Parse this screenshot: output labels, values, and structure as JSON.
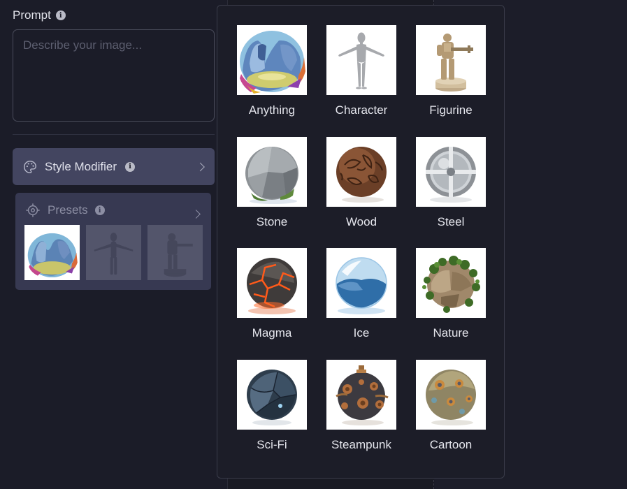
{
  "prompt": {
    "label": "Prompt",
    "placeholder": "Describe your image...",
    "value": ""
  },
  "style_modifier": {
    "label": "Style Modifier",
    "icon": "palette-icon"
  },
  "presets": {
    "label": "Presets",
    "icon": "target-icon",
    "thumbs": [
      "Anything",
      "Character",
      "Figurine"
    ]
  },
  "style_options": [
    {
      "label": "Anything"
    },
    {
      "label": "Character"
    },
    {
      "label": "Figurine"
    },
    {
      "label": "Stone"
    },
    {
      "label": "Wood"
    },
    {
      "label": "Steel"
    },
    {
      "label": "Magma"
    },
    {
      "label": "Ice"
    },
    {
      "label": "Nature"
    },
    {
      "label": "Sci-Fi"
    },
    {
      "label": "Steampunk"
    },
    {
      "label": "Cartoon"
    }
  ],
  "colors": {
    "background": "#1b1c28",
    "style_modifier_bg": "#434560",
    "presets_bg": "#373952",
    "popup_bg": "#1c1d28"
  }
}
